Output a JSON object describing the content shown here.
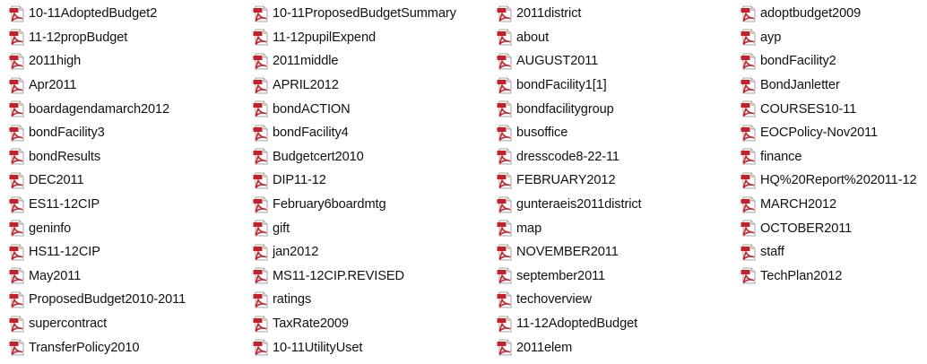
{
  "view": "list",
  "icon": "pdf-file-icon",
  "colors": {
    "pdf_red": "#c8202b",
    "pdf_page": "#ffffff",
    "text": "#111111"
  },
  "files": [
    "10-11AdoptedBudget2",
    "11-12propBudget",
    "2011high",
    "Apr2011",
    "boardagendamarch2012",
    "bondFacility3",
    "bondResults",
    "DEC2011",
    "ES11-12CIP",
    "geninfo",
    "HS11-12CIP",
    "May2011",
    "ProposedBudget2010-2011",
    "supercontract",
    "TransferPolicy2010",
    "10-11ProposedBudgetSummary",
    "11-12pupilExpend",
    "2011middle",
    "APRIL2012",
    "bondACTION",
    "bondFacility4",
    "Budgetcert2010",
    "DIP11-12",
    "February6boardmtg",
    "gift",
    "jan2012",
    "MS11-12CIP.REVISED",
    "ratings",
    "TaxRate2009",
    "10-11UtilityUset",
    "2011district",
    "about",
    "AUGUST2011",
    "bondFacility1[1]",
    "bondfacilitygroup",
    "busoffice",
    "dresscode8-22-11",
    "FEBRUARY2012",
    "gunteraeis2011district",
    "map",
    "NOVEMBER2011",
    "september2011",
    "techoverview",
    "11-12AdoptedBudget",
    "2011elem",
    "adoptbudget2009",
    "ayp",
    "bondFacility2",
    "BondJanletter",
    "COURSES10-11",
    "EOCPolicy-Nov2011",
    "finance",
    "HQ%20Report%202011-12",
    "MARCH2012",
    "OCTOBER2011",
    "staff",
    "TechPlan2012"
  ]
}
